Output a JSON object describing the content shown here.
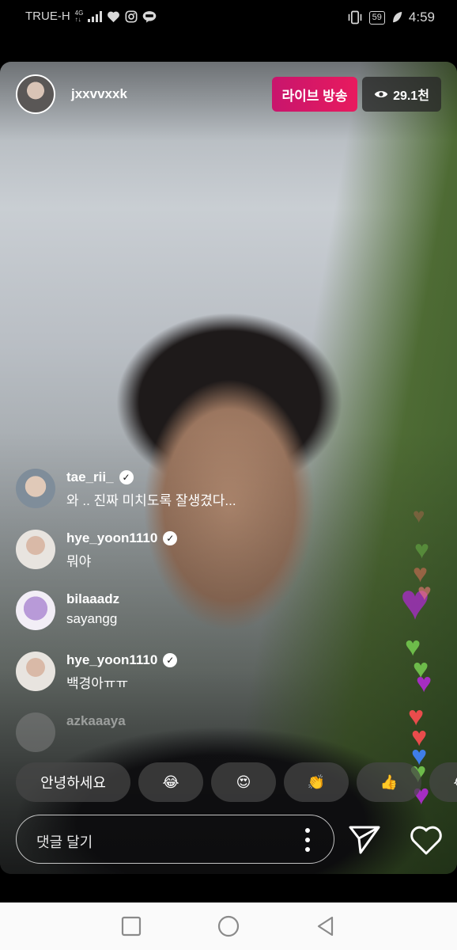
{
  "status_bar": {
    "carrier": "TRUE-H",
    "network_top": "4G",
    "network_bottom": "↑↓",
    "battery": "59",
    "time": "4:59",
    "icons": [
      "signal-icon",
      "heart-icon",
      "instagram-icon",
      "line-app-icon",
      "vibrate-icon",
      "battery-icon",
      "leaf-icon"
    ]
  },
  "live": {
    "host_username": "jxxvvxxk",
    "live_badge": "라이브 방송",
    "viewer_count": "29.1천"
  },
  "comments": [
    {
      "username": "tae_rii_",
      "verified": true,
      "message": "와 .. 진짜 미치도록 잘생겼다..."
    },
    {
      "username": "hye_yoon1110",
      "verified": true,
      "message": "뭐야"
    },
    {
      "username": "bilaaadz",
      "verified": false,
      "message": "sayangg"
    },
    {
      "username": "hye_yoon1110",
      "verified": true,
      "message": "백경아ㅠㅠ"
    },
    {
      "username": "azkaaaya",
      "verified": false,
      "message": ""
    }
  ],
  "quick_reactions": [
    {
      "label": "안녕하세요"
    },
    {
      "label": "😂"
    },
    {
      "label": "😍"
    },
    {
      "label": "👏"
    },
    {
      "label": "👍"
    },
    {
      "label": "😂"
    }
  ],
  "composer": {
    "placeholder": "댓글 달기"
  },
  "colors": {
    "live_badge": "#e0185f",
    "viewer_badge": "#2a2a2a",
    "navbar": "#fafafa"
  }
}
